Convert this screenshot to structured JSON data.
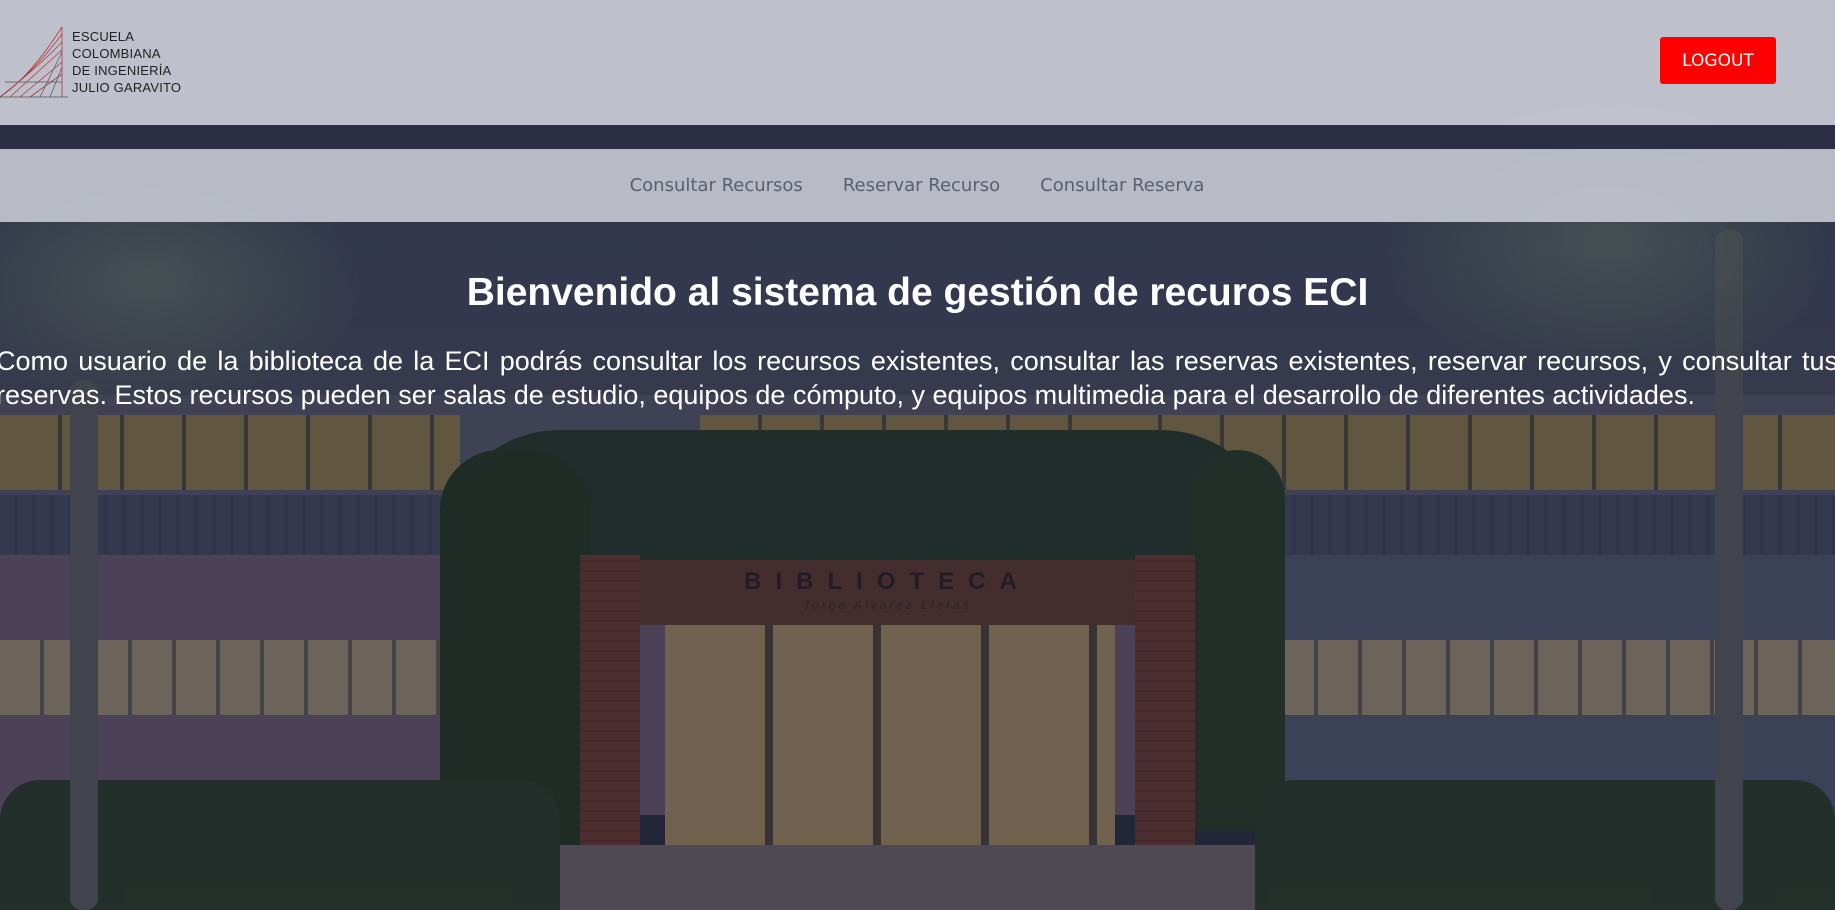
{
  "header": {
    "logo_lines": [
      "ESCUELA",
      "COLOMBIANA",
      "DE INGENIERÍA",
      "JULIO GARAVITO"
    ],
    "logout_label": "LOGOUT"
  },
  "nav": {
    "items": [
      {
        "label": "Consultar Recursos"
      },
      {
        "label": "Reservar Recurso"
      },
      {
        "label": "Consultar Reserva"
      }
    ]
  },
  "main": {
    "title": "Bienvenido al sistema de gestión de recuros ECI",
    "intro": "Como usuario de la biblioteca de la ECI podrás consultar los recursos existentes, consultar las reservas existentes, reservar recursos, y consultar tus reservas. Estos recursos pueden ser salas de estudio, equipos de cómputo, y equipos multimedia para el desarrollo de diferentes actividades."
  },
  "background": {
    "sign_text": "BIBLIOTECA",
    "sign_subtext": "Jorge Alvarez Lleras"
  },
  "colors": {
    "logout": "#ff0000",
    "header_bg": "#d6d8e2",
    "text_light": "#ffffff"
  }
}
